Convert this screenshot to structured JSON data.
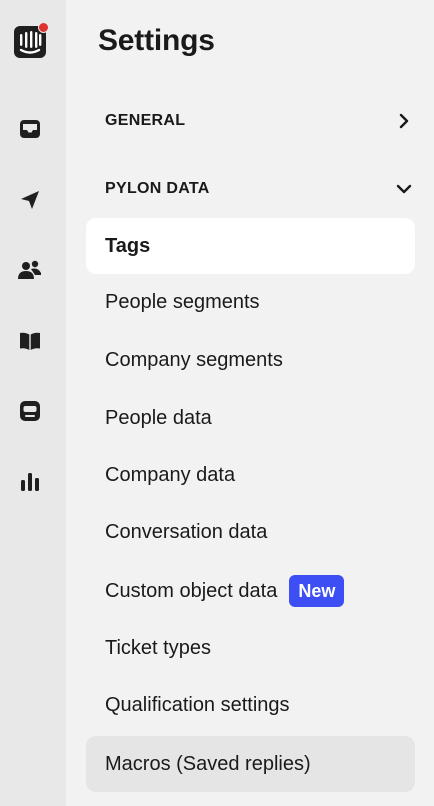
{
  "page": {
    "title": "Settings"
  },
  "rail": {
    "icons": [
      "intercom-logo-icon",
      "inbox-icon",
      "outbound-send-icon",
      "contacts-icon",
      "knowledge-book-icon",
      "messenger-icon",
      "reports-chart-icon"
    ],
    "notification_color": "#e03131"
  },
  "sections": [
    {
      "label": "GENERAL",
      "state": "collapsed"
    },
    {
      "label": "PYLON DATA",
      "state": "expanded"
    }
  ],
  "items": [
    {
      "label": "Tags",
      "state": "active"
    },
    {
      "label": "People segments"
    },
    {
      "label": "Company segments"
    },
    {
      "label": "People data"
    },
    {
      "label": "Company data"
    },
    {
      "label": "Conversation data"
    },
    {
      "label": "Custom object data",
      "badge": "New"
    },
    {
      "label": "Ticket types"
    },
    {
      "label": "Qualification settings"
    },
    {
      "label": "Macros (Saved replies)",
      "state": "hover"
    }
  ],
  "colors": {
    "badge": "#3d4ef5",
    "active_bg": "#ffffff",
    "hover_bg": "#e5e5e5"
  }
}
